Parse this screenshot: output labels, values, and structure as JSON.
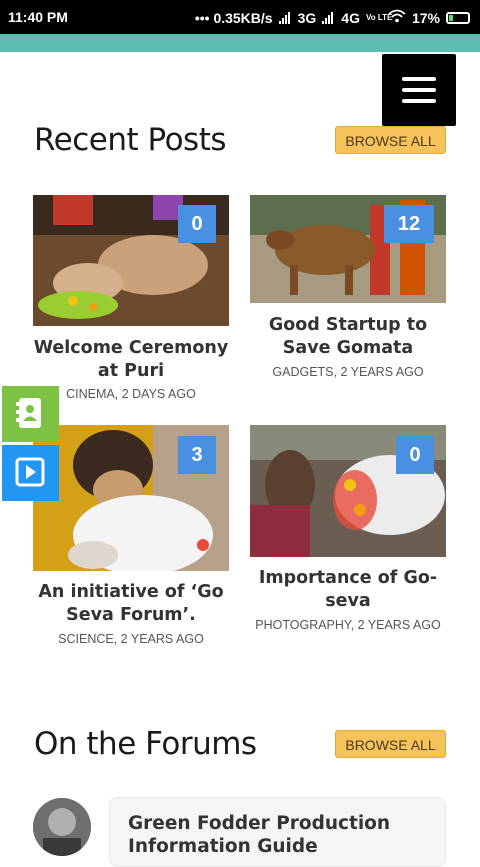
{
  "status_bar": {
    "time": "11:40 PM",
    "network_speed": "••• 0.35KB/s",
    "net_3g": "3G",
    "net_4g": "4G",
    "volte": "Vo LTE",
    "battery": "17%"
  },
  "header": {
    "menu_icon": "hamburger-menu-icon"
  },
  "recent_posts": {
    "title": "Recent Posts",
    "browse_label": "BROWSE ALL",
    "posts": [
      {
        "title": "Welcome Ceremony at Puri",
        "meta": "CINEMA, 2 DAYS AGO",
        "comments": "0"
      },
      {
        "title": "Good Startup to Save Gomata",
        "meta": "GADGETS, 2 YEARS AGO",
        "comments": "12"
      },
      {
        "title": "An initiative of ‘Go Seva Forum’.",
        "meta": "SCIENCE, 2 YEARS AGO",
        "comments": "3"
      },
      {
        "title": "Importance of Go-seva",
        "meta": "PHOTOGRAPHY, 2 YEARS AGO",
        "comments": "0"
      }
    ]
  },
  "floating": {
    "contact_icon": "contact-book-icon",
    "video_icon": "video-play-icon",
    "contact_color": "#7dc242",
    "video_color": "#2196f3"
  },
  "forums": {
    "title": "On the Forums",
    "browse_label": "BROWSE ALL",
    "items": [
      {
        "title": "Green Fodder Production Information Guide"
      }
    ]
  },
  "colors": {
    "accent_teal": "#5ebdb3",
    "badge_blue": "#4a90e2",
    "browse_yellow": "#f6c25a"
  }
}
